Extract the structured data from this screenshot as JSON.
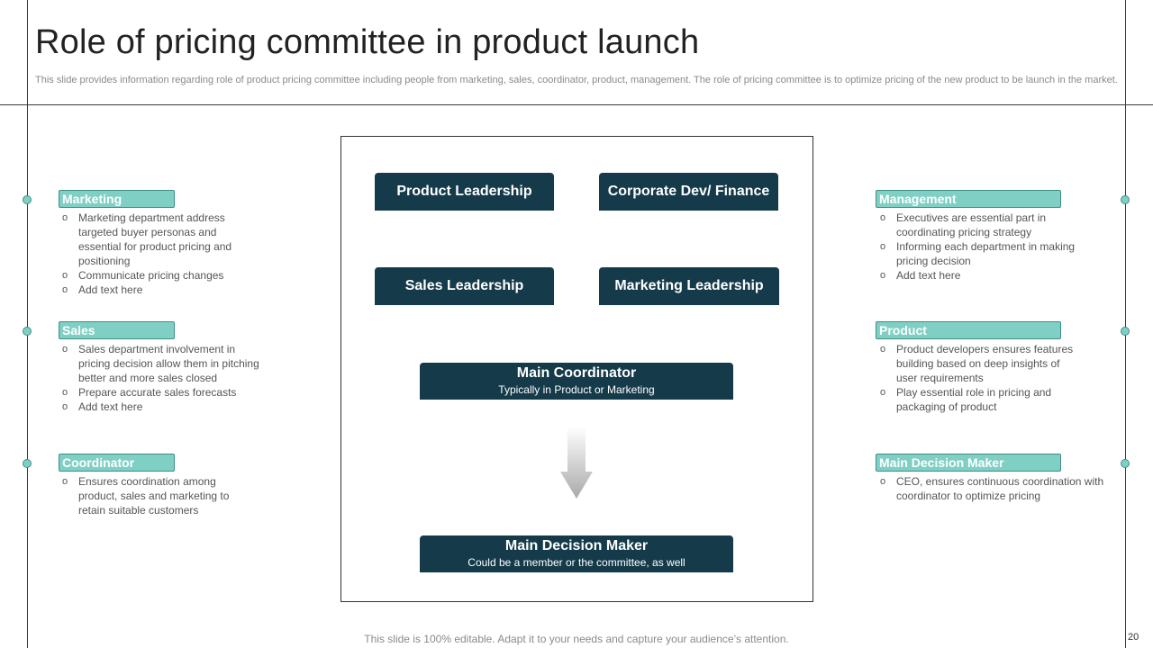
{
  "slide": {
    "title": "Role of pricing committee in product launch",
    "subtitle": "This slide provides information regarding role of product pricing committee including people from marketing, sales, coordinator, product, management. The role of pricing committee is to optimize pricing of the new product to be launch in the market.",
    "footer": "This slide is 100% editable. Adapt it to your needs and capture your audience’s attention.",
    "page_number": "20"
  },
  "colors": {
    "dark_block": "#153a4a",
    "teal_label": "#7fcfc4",
    "teal_border": "#3f8f86"
  },
  "center": {
    "product_leadership": "Product Leadership",
    "corporate_dev": "Corporate Dev/ Finance",
    "sales_leadership": "Sales Leadership",
    "marketing_leadership": "Marketing Leadership",
    "coordinator_title": "Main Coordinator",
    "coordinator_sub": "Typically in Product or Marketing",
    "decision_title": "Main Decision Maker",
    "decision_sub": "Could be a member or the committee, as well"
  },
  "left": {
    "marketing": {
      "label": "Marketing",
      "items": [
        "Marketing department address targeted buyer personas and essential for product pricing and positioning",
        "Communicate pricing changes",
        "Add text here"
      ]
    },
    "sales": {
      "label": "Sales",
      "items": [
        "Sales department involvement in pricing decision allow them in pitching better and more sales closed",
        "Prepare accurate sales forecasts",
        "Add text here"
      ]
    },
    "coordinator": {
      "label": "Coordinator",
      "items": [
        "Ensures coordination among product, sales and marketing to retain suitable customers"
      ]
    }
  },
  "right": {
    "management": {
      "label": "Management",
      "items": [
        "Executives are essential part in coordinating pricing strategy",
        "Informing each department in making pricing decision",
        "Add text here"
      ]
    },
    "product": {
      "label": "Product",
      "items": [
        "Product developers ensures features building based on deep insights of user requirements",
        "Play essential role in pricing and packaging of product"
      ]
    },
    "decision_maker": {
      "label": "Main Decision Maker",
      "items": [
        "CEO, ensures continuous coordination with coordinator to optimize pricing"
      ]
    }
  }
}
